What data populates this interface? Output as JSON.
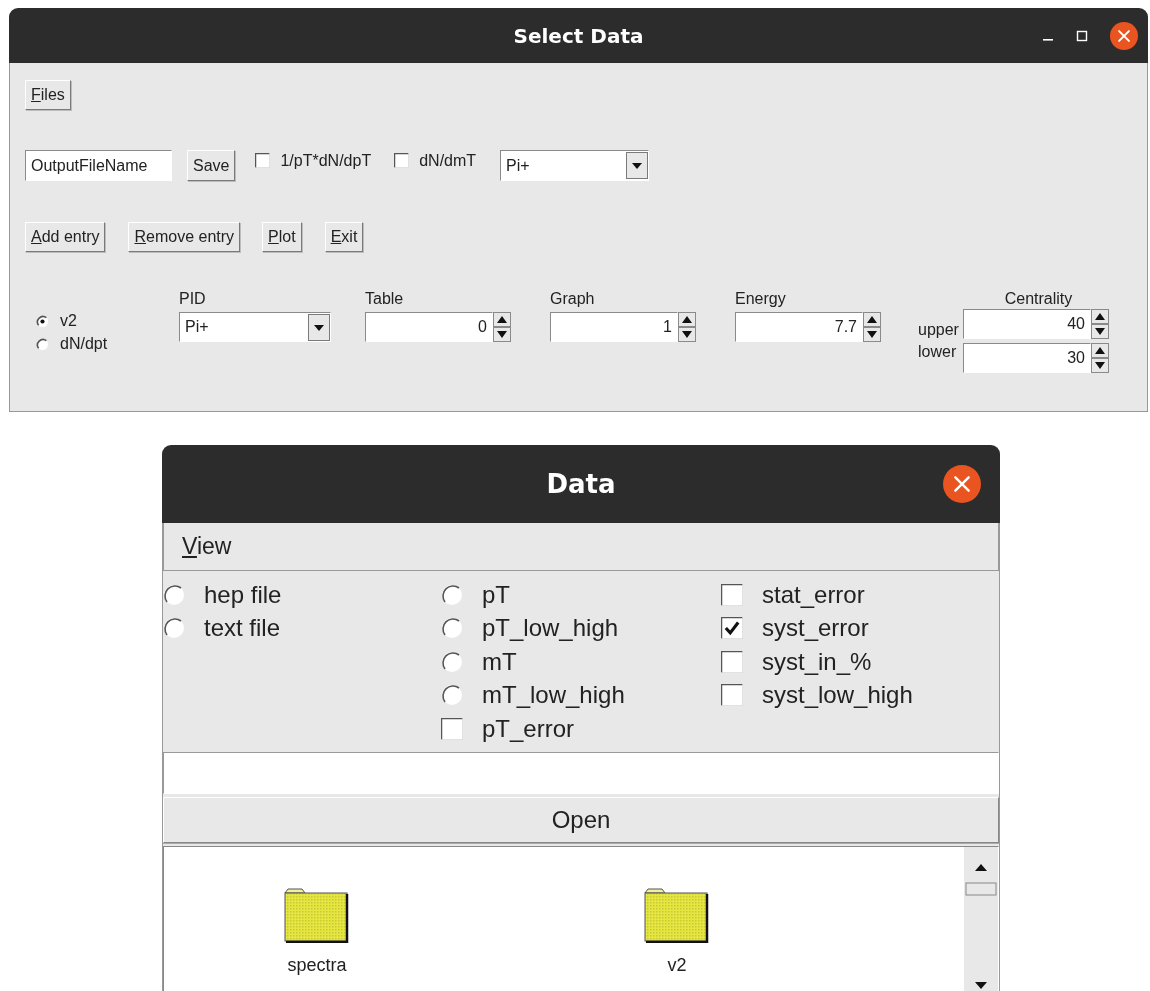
{
  "select_window": {
    "title": "Select Data",
    "menu_buttons": [
      {
        "label": "Files",
        "underline_first": true
      }
    ],
    "output_field": {
      "value": "OutputFileName"
    },
    "save_button": {
      "label": "Save",
      "underline_first": false
    },
    "checkboxes": [
      {
        "label": "1/pT*dN/dpT",
        "checked": false
      },
      {
        "label": "dN/dmT",
        "checked": false
      }
    ],
    "particle_combo": {
      "value": "Pi+"
    },
    "actions": [
      {
        "label": "Add entry",
        "underline_first": true
      },
      {
        "label": "Remove entry",
        "underline_first": true
      },
      {
        "label": "Plot",
        "underline_first": true
      },
      {
        "label": "Exit",
        "underline_first": true
      }
    ],
    "mode_radios": [
      {
        "label": "v2",
        "selected": true
      },
      {
        "label": "dN/dpt",
        "selected": false
      }
    ],
    "pid": {
      "label": "PID",
      "value": "Pi+"
    },
    "spinners": [
      {
        "label": "Table",
        "value": "0"
      },
      {
        "label": "Graph",
        "value": "1"
      },
      {
        "label": "Energy",
        "value": "7.7"
      }
    ],
    "centrality": {
      "label": "Centrality",
      "bounds": [
        {
          "label": "upper",
          "value": "40"
        },
        {
          "label": "lower",
          "value": "30"
        }
      ]
    }
  },
  "data_window": {
    "title": "Data",
    "menu": [
      {
        "label": "View",
        "underline_first": true
      }
    ],
    "option_columns": [
      [
        {
          "kind": "radio",
          "label": "hep file",
          "selected": false
        },
        {
          "kind": "radio",
          "label": "text file",
          "selected": false
        }
      ],
      [
        {
          "kind": "radio",
          "label": "pT",
          "selected": false
        },
        {
          "kind": "radio",
          "label": "pT_low_high",
          "selected": false
        },
        {
          "kind": "radio",
          "label": "mT",
          "selected": false
        },
        {
          "kind": "radio",
          "label": "mT_low_high",
          "selected": false
        },
        {
          "kind": "checkbox",
          "label": "pT_error",
          "checked": false
        }
      ],
      [
        {
          "kind": "checkbox",
          "label": "stat_error",
          "checked": false
        },
        {
          "kind": "checkbox",
          "label": "syst_error",
          "checked": true
        },
        {
          "kind": "checkbox",
          "label": "syst_in_%",
          "checked": false
        },
        {
          "kind": "checkbox",
          "label": "syst_low_high",
          "checked": false
        }
      ]
    ],
    "open_button": {
      "label": "Open"
    },
    "files": [
      {
        "name": "spectra"
      },
      {
        "name": "v2"
      }
    ]
  }
}
